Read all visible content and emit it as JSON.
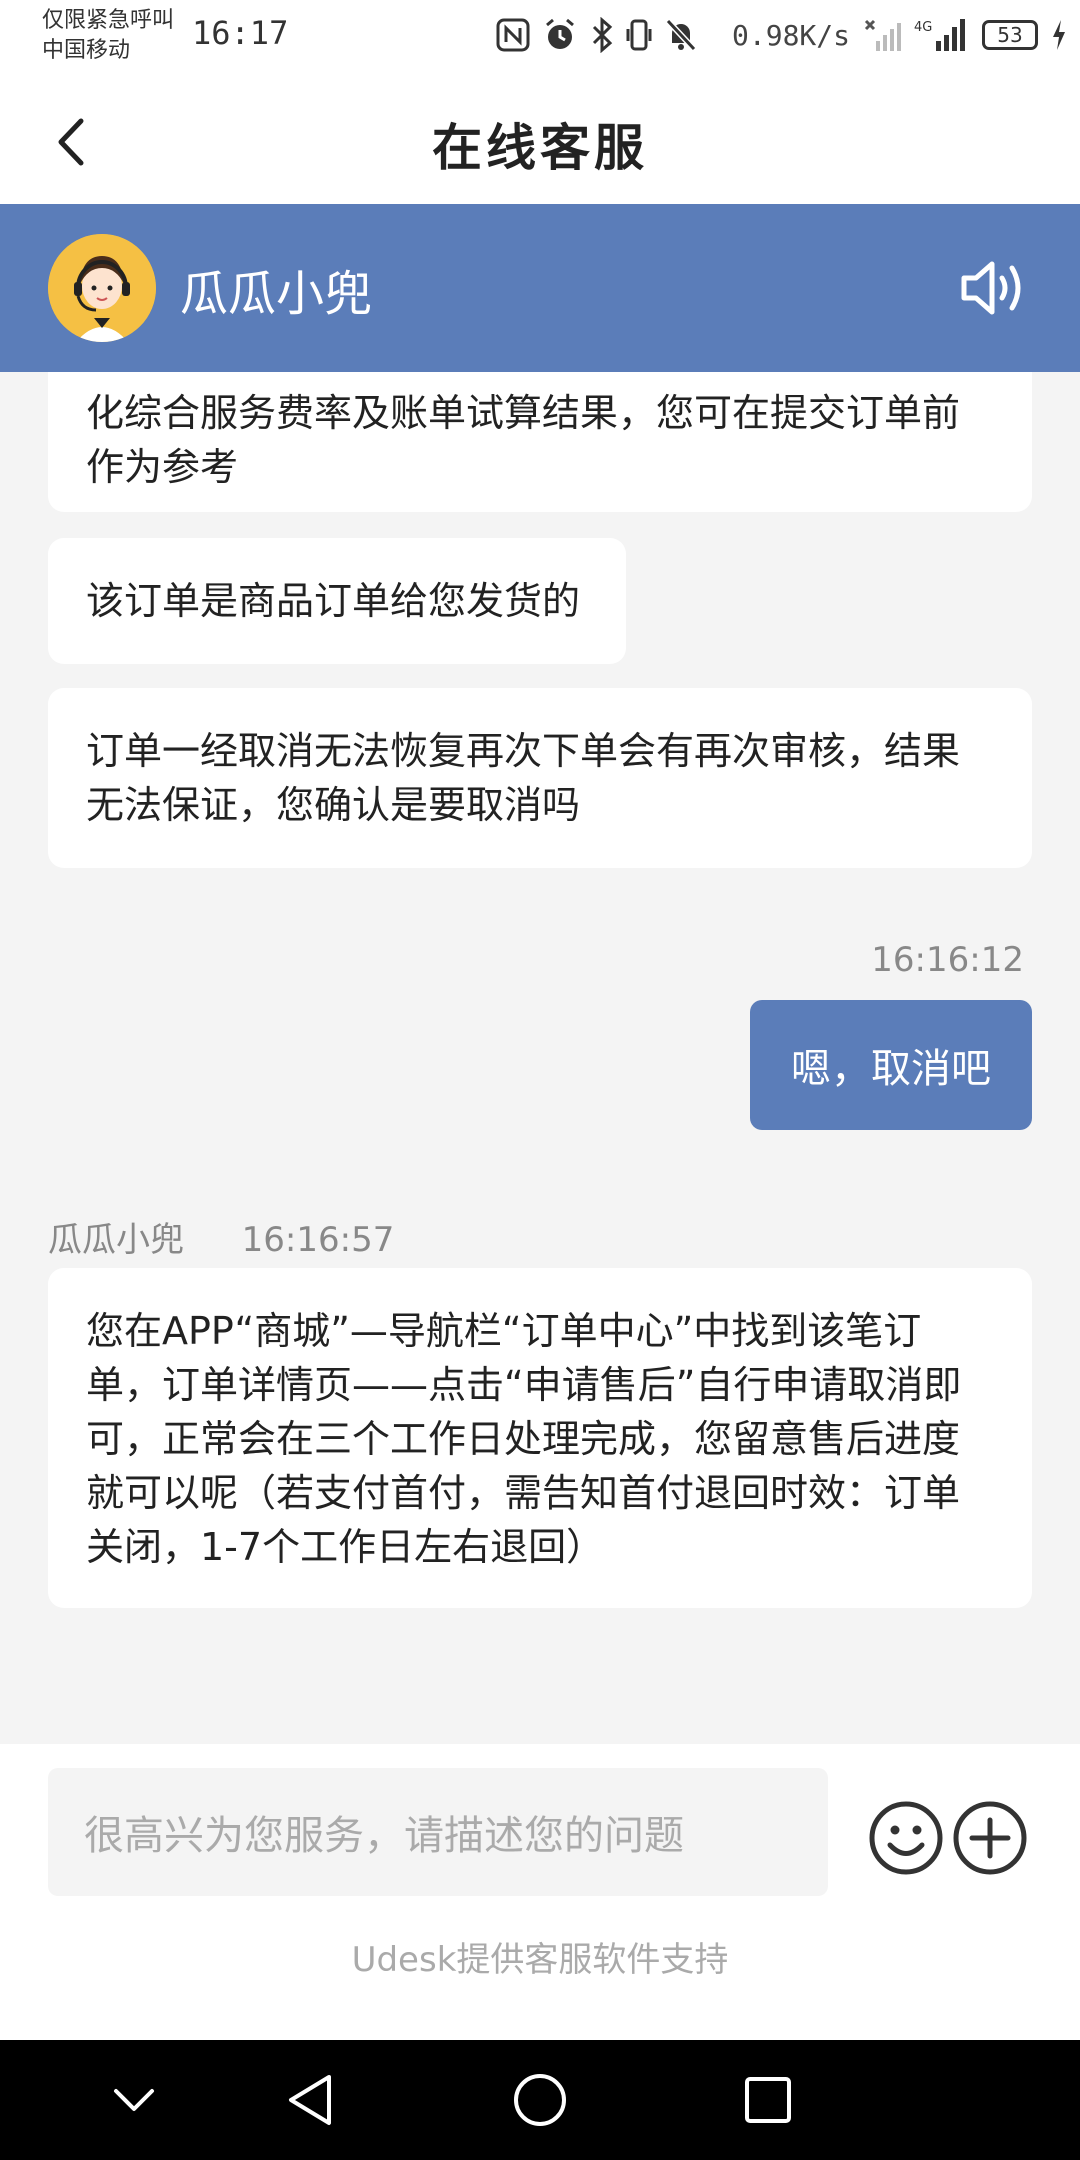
{
  "status_bar": {
    "carrier_line1": "仅限紧急呼叫",
    "carrier_line2": "中国移动",
    "time": "16:17",
    "net_speed": "0.98K/s",
    "battery": "53",
    "network_type": "4G",
    "icons": [
      "nfc-icon",
      "alarm-icon",
      "bluetooth-icon",
      "vibrate-icon",
      "mute-icon",
      "no-sim-icon",
      "signal-icon",
      "battery-icon",
      "charging-icon"
    ]
  },
  "header": {
    "title": "在线客服",
    "back_icon": "chevron-left-icon"
  },
  "agent": {
    "name": "瓜瓜小兜",
    "speaker_icon": "speaker-icon",
    "avatar_icon": "customer-service-avatar"
  },
  "messages": {
    "m1": "化综合服务费率及账单试算结果，您可在提交订单前作为参考",
    "m2": "该订单是商品订单给您发货的",
    "m3": "订单一经取消无法恢复再次下单会有再次审核，结果无法保证，您确认是要取消吗",
    "user_time": "16:16:12",
    "user_text": "嗯，取消吧",
    "agent_name": "瓜瓜小兜",
    "agent_time": "16:16:57",
    "m4": "您在APP“商城”—导航栏“订单中心”中找到该笔订单，订单详情页——点击“申请售后”自行申请取消即可，正常会在三个工作日处理完成，您留意售后进度就可以呢（若支付首付，需告知首付退回时效：订单关闭，1-7个工作日左右退回）"
  },
  "input": {
    "placeholder": "很高兴为您服务，请描述您的问题",
    "emoji_icon": "emoji-icon",
    "plus_icon": "plus-circle-icon"
  },
  "footer": {
    "powered_by": "Udesk提供客服软件支持"
  },
  "nav": [
    "chevron-down-icon",
    "back-triangle-icon",
    "home-circle-icon",
    "recent-square-icon"
  ],
  "colors": {
    "accent": "#5b7db9",
    "background": "#f4f4f4"
  }
}
